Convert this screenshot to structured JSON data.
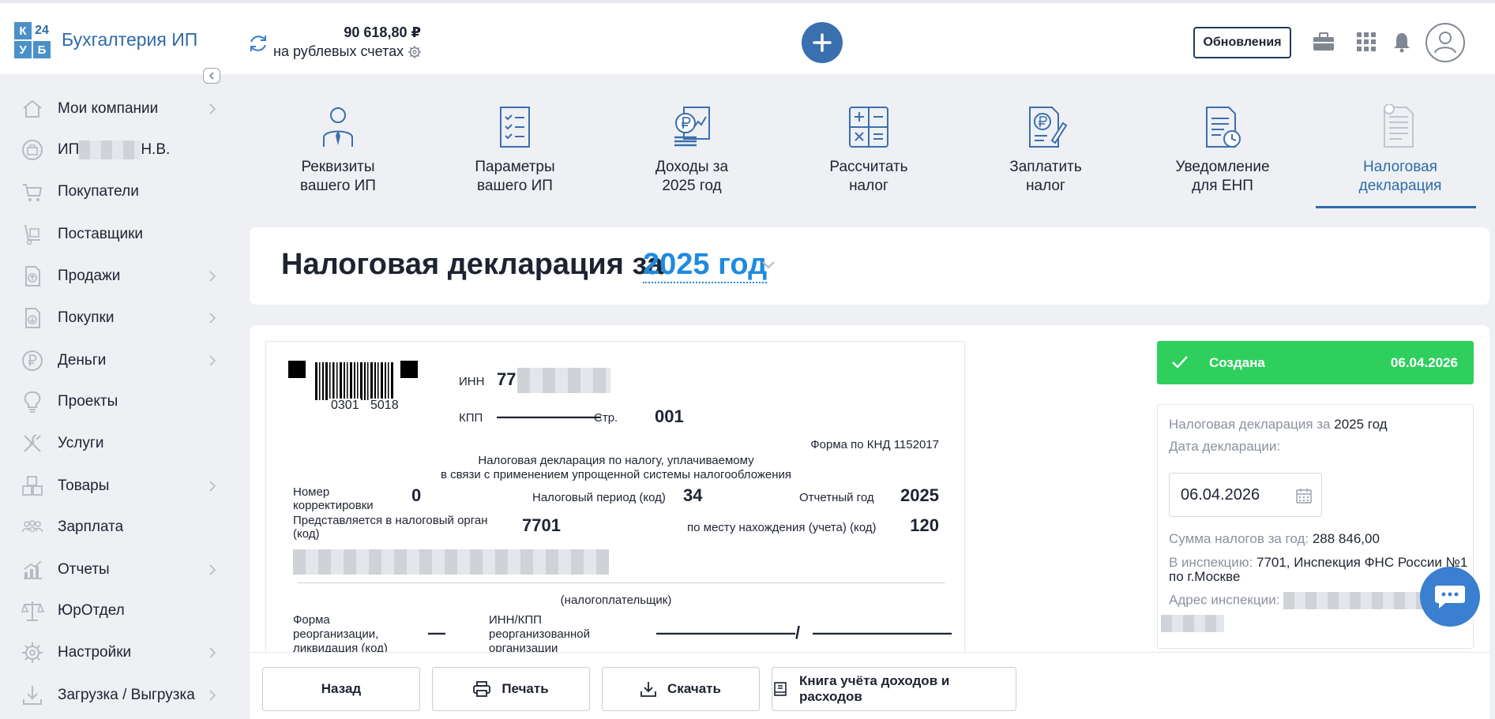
{
  "app": {
    "logo_tl": "К",
    "logo_tr": "24",
    "logo_bl": "У",
    "logo_br": "Б",
    "name": "Бухгалтерия ИП"
  },
  "balance": {
    "amount": "90 618,80 ₽",
    "label": "на рублевых счетах"
  },
  "header": {
    "updates_label": "Обновления"
  },
  "sidebar": {
    "items": [
      {
        "label": "Мои компании",
        "icon": "home-icon"
      },
      {
        "label_prefix": "ИП",
        "label_suffix": "Н.В.",
        "icon": "briefcase-icon"
      },
      {
        "label": "Покупатели",
        "icon": "cart-icon"
      },
      {
        "label": "Поставщики",
        "icon": "dolly-icon"
      },
      {
        "label": "Продажи",
        "icon": "sales-doc-icon"
      },
      {
        "label": "Покупки",
        "icon": "purchase-doc-icon"
      },
      {
        "label": "Деньги",
        "icon": "ruble-coin-icon"
      },
      {
        "label": "Проекты",
        "icon": "lightbulb-icon"
      },
      {
        "label": "Услуги",
        "icon": "tools-icon"
      },
      {
        "label": "Товары",
        "icon": "boxes-icon"
      },
      {
        "label": "Зарплата",
        "icon": "people-icon"
      },
      {
        "label": "Отчеты",
        "icon": "chart-icon"
      },
      {
        "label": "ЮрОтдел",
        "icon": "scales-icon"
      },
      {
        "label": "Настройки",
        "icon": "gear-icon"
      },
      {
        "label": "Загрузка / Выгрузка",
        "icon": "download-icon"
      }
    ]
  },
  "tiles": [
    {
      "line1": "Реквизиты",
      "line2": "вашего ИП",
      "icon": "person-icon"
    },
    {
      "line1": "Параметры",
      "line2": "вашего ИП",
      "icon": "checklist-icon"
    },
    {
      "line1": "Доходы за",
      "line2": "2025 год",
      "icon": "coins-icon"
    },
    {
      "line1": "Рассчитать",
      "line2": "налог",
      "icon": "calculator-icon"
    },
    {
      "line1": "Заплатить",
      "line2": "налог",
      "icon": "pay-doc-icon"
    },
    {
      "line1": "Уведомление",
      "line2": "для ЕНП",
      "icon": "notice-clock-icon"
    },
    {
      "line1": "Налоговая",
      "line2": "декларация",
      "icon": "declaration-icon",
      "active": true
    }
  ],
  "page": {
    "title": "Налоговая декларация за",
    "year": "2025 год"
  },
  "doc": {
    "barcode_number_1": "0301",
    "barcode_number_2": "5018",
    "inn_label": "ИНН",
    "inn_value": "77",
    "kpp_label": "КПП",
    "kpp_value": "——————",
    "page_label": "Стр.",
    "page_value": "001",
    "form_code": "Форма по КНД 1152017",
    "title_line1": "Налоговая декларация по налогу, уплачиваемому",
    "title_line2": "в связи с применением упрощенной системы налогообложения",
    "correction_label_1": "Номер",
    "correction_label_2": "корректировки",
    "correction_value": "0",
    "period_label": "Налоговый период (код)",
    "period_value": "34",
    "year_label": "Отчетный год",
    "year_value": "2025",
    "authority_label_1": "Представляется в налоговый орган",
    "authority_label_2": "(код)",
    "authority_value": "7701",
    "location_label": "по месту нахождения (учета) (код)",
    "location_value": "120",
    "taxpayer_caption": "(налогоплательщик)",
    "reorg_label_1": "Форма",
    "reorg_label_2": "реорганизации,",
    "reorg_label_3": "ликвидация (код)",
    "reorg_value": "—",
    "reorg_inn_label_1": "ИНН/КПП",
    "reorg_inn_label_2": "реорганизованной",
    "reorg_inn_label_3": "организации",
    "reorg_inn_value": "————————",
    "reorg_slash": "/",
    "reorg_kpp_value": "————————"
  },
  "status": {
    "label": "Создана",
    "date": "06.04.2026",
    "color": "#2fcf5e"
  },
  "info": {
    "declaration_label": "Налоговая декларация за",
    "declaration_year": "2025 год",
    "date_label": "Дата декларации:",
    "date_value": "06.04.2026",
    "sum_label": "Сумма налогов за год:",
    "sum_value": "288 846,00",
    "inspection_label": "В инспекцию:",
    "inspection_value_1": "7701, Инспекция ФНС России №1",
    "inspection_value_2": "по г.Москве",
    "address_label": "Адрес инспекции:"
  },
  "actions": {
    "back": "Назад",
    "print": "Печать",
    "download": "Скачать",
    "book": "Книга учёта доходов и расходов"
  },
  "colors": {
    "accent": "#2e6ba8",
    "link": "#1f8ae0",
    "success": "#2fcf5e",
    "chat": "#3a7fd0"
  }
}
